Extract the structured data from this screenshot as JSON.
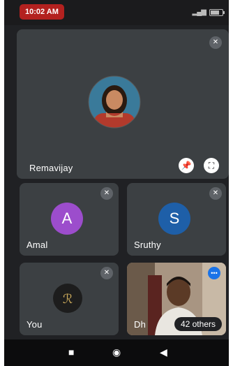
{
  "status_bar": {
    "time": "10:02 AM",
    "signal_icon": "signal-icon",
    "battery_icon": "battery-icon"
  },
  "participants": {
    "main": {
      "name": "Remavijay",
      "muted": true
    },
    "amal": {
      "name": "Amal",
      "initial": "A",
      "color": "#9c4dcc",
      "muted": true
    },
    "sruthy": {
      "name": "Sruthy",
      "initial": "S",
      "color": "#1e5fa8",
      "muted": true
    },
    "you": {
      "name": "You",
      "muted": true
    },
    "video": {
      "name": "Dh",
      "others_label": "42 others"
    }
  },
  "controls": {
    "pin_icon": "pin-icon",
    "fullscreen_icon": "fullscreen-icon"
  },
  "nav": {
    "recents_icon": "recents-icon",
    "home_icon": "home-icon",
    "back_icon": "back-icon"
  }
}
